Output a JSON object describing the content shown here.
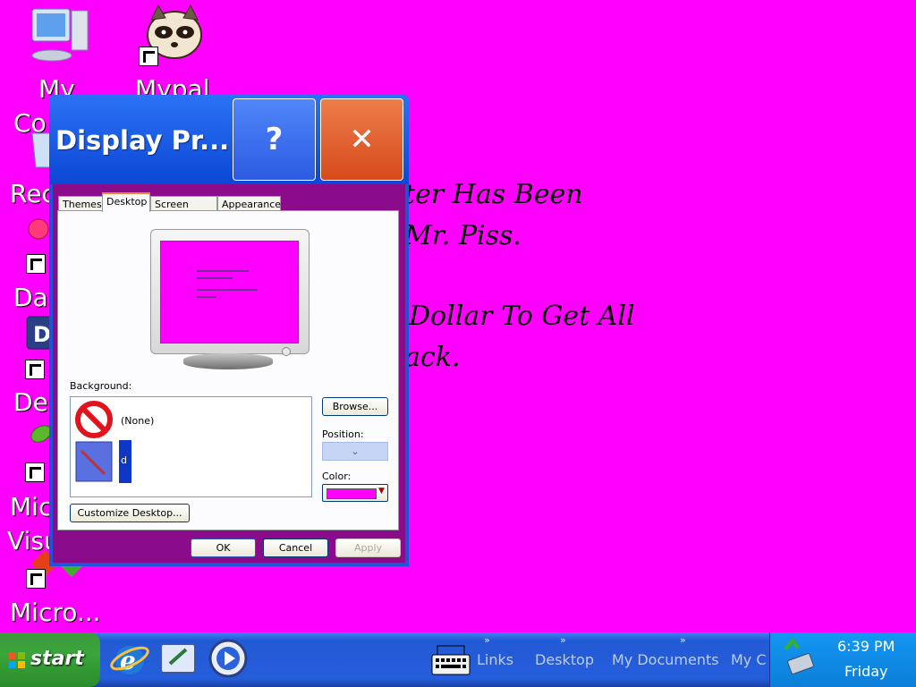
{
  "desktop": {
    "background_color": "#ff00ff",
    "icons": [
      {
        "label": "My",
        "label2": "Co",
        "name": "my-computer"
      },
      {
        "label": "Mypal",
        "name": "mypal"
      },
      {
        "label": "Rec",
        "name": "recycle-bin"
      },
      {
        "label": "Da",
        "name": "shortcut-da"
      },
      {
        "label": "De",
        "name": "shortcut-de"
      },
      {
        "label": "Mic",
        "label2": "Visu",
        "name": "microsoft-visual"
      },
      {
        "label": "Micro...",
        "name": "microsoft"
      }
    ],
    "message_lines": [
      "ter Has Been",
      "Mr. Piss.",
      "Dollar To Get All",
      "ack."
    ]
  },
  "window": {
    "title": "Display Pr...",
    "help_label": "?",
    "close_label": "✕",
    "tabs": [
      {
        "label": "Themes",
        "active": false
      },
      {
        "label": "Desktop",
        "active": true
      },
      {
        "label": "Screen Saver",
        "active": false
      },
      {
        "label": "Appearance",
        "active": false
      }
    ],
    "background_label": "Background:",
    "background_items": [
      {
        "label": "(None)",
        "icon": "no-entry-icon"
      },
      {
        "label": "d",
        "icon": "wallpaper-image-icon"
      }
    ],
    "browse_label": "Browse...",
    "position_label": "Position:",
    "position_value": "",
    "color_label": "Color:",
    "color_value": "#ff00ff",
    "customize_label": "Customize Desktop...",
    "ok_label": "OK",
    "cancel_label": "Cancel",
    "apply_label": "Apply"
  },
  "taskbar": {
    "start_label": "start",
    "toolbars": [
      "Links",
      "Desktop",
      "My Documents",
      "My C"
    ],
    "chevron": "»",
    "clock": "6:39 PM",
    "day": "Friday"
  }
}
